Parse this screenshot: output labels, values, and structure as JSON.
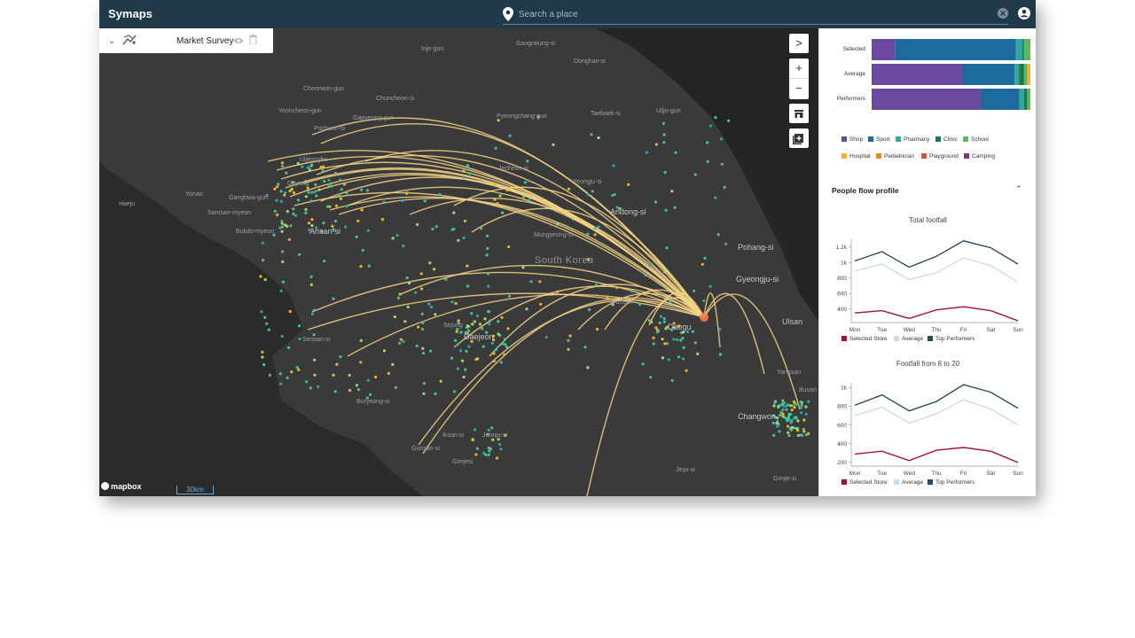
{
  "app": {
    "title": "Symaps"
  },
  "search": {
    "placeholder": "Search a place"
  },
  "layer": {
    "name": "Market Survey"
  },
  "map": {
    "country_label": "South Korea",
    "attribution": "mapbox",
    "scale_label": "30km",
    "cities_small": [
      "Gangneung-si",
      "Inje-gun",
      "Donghae-si",
      "Cheorwon-gun",
      "Chuncheon-si",
      "Yeoncheon-gun",
      "Gapyeong-gun",
      "Pyeongchang-gun",
      "Taebaek-si",
      "Uljin-gun",
      "Pocheon-si",
      "Uijeongbu",
      "Jecheon-si",
      "Goyang",
      "Yeongju-si",
      "Yonan",
      "Ganghwa-gun",
      "Samsan-myeon",
      "Haeju",
      "Bukdo-myeon",
      "Mungyeong-si",
      "Gumi-si",
      "Sejong",
      "Seosan-si",
      "Boryeong-si",
      "Iksan-si",
      "Gunsan-si",
      "Gimjesi",
      "Jeonju-si",
      "Jinju-si",
      "Yangsan",
      "Gyeongju-si",
      "Geoje-si",
      "Ulsan",
      "Busan"
    ],
    "cities_big": [
      "Andong-si",
      "Ansan-si",
      "Daejeon",
      "Daegu",
      "Pohang-si",
      "Gyeongju-si",
      "Changwon",
      "Ulsan"
    ]
  },
  "controls": {
    "expand": ">",
    "zoom_in": "+",
    "zoom_out": "−"
  },
  "side": {
    "bar_rows": [
      {
        "label": "Selected",
        "segments": [
          0.15,
          0.76,
          0.04,
          0.01,
          0.04
        ]
      },
      {
        "label": "Average",
        "segments": [
          0.57,
          0.33,
          0.03,
          0.03,
          0.02,
          0.02
        ]
      },
      {
        "label": "Performers",
        "segments": [
          0.69,
          0.24,
          0.03,
          0.02,
          0.02
        ]
      }
    ],
    "categories": [
      {
        "name": "Shop",
        "color": "#6a4ba0"
      },
      {
        "name": "Sport",
        "color": "#1d6b9e"
      },
      {
        "name": "Pharmacy",
        "color": "#34a89f"
      },
      {
        "name": "Clinic",
        "color": "#1a7a4a"
      },
      {
        "name": "School",
        "color": "#5cb85c"
      },
      {
        "name": "Hospital",
        "color": "#f0b323"
      },
      {
        "name": "Pediatrician",
        "color": "#e38b1c"
      },
      {
        "name": "Playground",
        "color": "#d9533c"
      },
      {
        "name": "Camping",
        "color": "#8e2b6b"
      }
    ],
    "flow_title": "People flow profile",
    "legend": [
      "Selected Store",
      "Average",
      "Top Performers"
    ]
  },
  "chart_data": [
    {
      "type": "line",
      "title": "Total footfall",
      "categories": [
        "Mon",
        "Tue",
        "Wed",
        "Thu",
        "Fri",
        "Sat",
        "Sun"
      ],
      "yticks": [
        "1.2k",
        "1k",
        "800",
        "600",
        "400"
      ],
      "ylim": [
        250,
        1300
      ],
      "series": [
        {
          "name": "Selected Store",
          "color": "#a3123a",
          "values": [
            350,
            380,
            280,
            390,
            430,
            380,
            250
          ]
        },
        {
          "name": "Average",
          "color": "#c9dcee",
          "values": [
            890,
            980,
            780,
            870,
            1060,
            960,
            750
          ]
        },
        {
          "name": "Top Performers",
          "color": "#2b4a5e",
          "values": [
            1020,
            1140,
            940,
            1080,
            1280,
            1190,
            980
          ]
        }
      ]
    },
    {
      "type": "line",
      "title": "Footfall from 8 to 20",
      "categories": [
        "Mon",
        "Tue",
        "Wed",
        "Thu",
        "Fri",
        "Sat",
        "Sun"
      ],
      "yticks": [
        "1k",
        "800",
        "600",
        "400",
        "200"
      ],
      "ylim": [
        180,
        1050
      ],
      "series": [
        {
          "name": "Selected Store",
          "color": "#a3123a",
          "values": [
            290,
            320,
            220,
            330,
            360,
            320,
            200
          ]
        },
        {
          "name": "Average",
          "color": "#c9dcee",
          "values": [
            700,
            790,
            620,
            720,
            870,
            770,
            600
          ]
        },
        {
          "name": "Top Performers",
          "color": "#2b4a5e",
          "values": [
            810,
            920,
            750,
            850,
            1030,
            950,
            780
          ]
        }
      ]
    }
  ]
}
